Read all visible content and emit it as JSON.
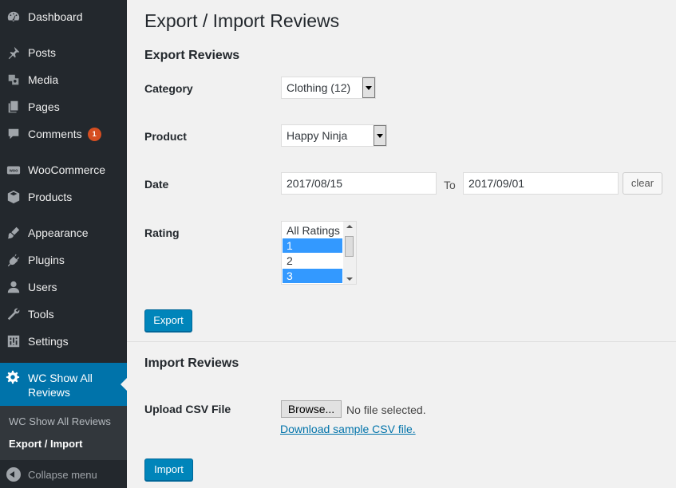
{
  "sidebar": {
    "items": [
      {
        "label": "Dashboard",
        "icon": "dashboard-icon"
      },
      {
        "label": "Posts",
        "icon": "pin-icon"
      },
      {
        "label": "Media",
        "icon": "media-icon"
      },
      {
        "label": "Pages",
        "icon": "pages-icon"
      },
      {
        "label": "Comments",
        "icon": "comments-icon",
        "badge": "1"
      },
      {
        "label": "WooCommerce",
        "icon": "woocommerce-icon"
      },
      {
        "label": "Products",
        "icon": "products-icon"
      },
      {
        "label": "Appearance",
        "icon": "brush-icon"
      },
      {
        "label": "Plugins",
        "icon": "plug-icon"
      },
      {
        "label": "Users",
        "icon": "user-icon"
      },
      {
        "label": "Tools",
        "icon": "wrench-icon"
      },
      {
        "label": "Settings",
        "icon": "settings-icon"
      }
    ],
    "active": {
      "label": "WC Show All Reviews",
      "icon": "gear-icon"
    },
    "submenu": [
      "WC Show All Reviews",
      "Export / Import"
    ],
    "collapse_label": "Collapse menu",
    "colors": {
      "bg": "#23282d",
      "active": "#0073aa",
      "badge": "#d54e21"
    }
  },
  "page": {
    "title": "Export / Import Reviews",
    "export": {
      "heading": "Export Reviews",
      "category_label": "Category",
      "category_value": "Clothing (12)",
      "product_label": "Product",
      "product_value": "Happy Ninja",
      "date_label": "Date",
      "date_from": "2017/08/15",
      "to_label": "To",
      "date_to": "2017/09/01",
      "clear_label": "clear",
      "rating_label": "Rating",
      "rating_options": [
        {
          "label": "All Ratings",
          "selected": false
        },
        {
          "label": "1",
          "selected": true
        },
        {
          "label": "2",
          "selected": false
        },
        {
          "label": "3",
          "selected": true
        }
      ],
      "export_button": "Export"
    },
    "import": {
      "heading": "Import Reviews",
      "upload_label": "Upload CSV File",
      "browse_label": "Browse...",
      "no_file": "No file selected.",
      "sample_link": "Download sample CSV file.",
      "import_button": "Import"
    },
    "colors": {
      "primary": "#0085ba",
      "link": "#0073aa",
      "selection": "#3399ff"
    }
  }
}
